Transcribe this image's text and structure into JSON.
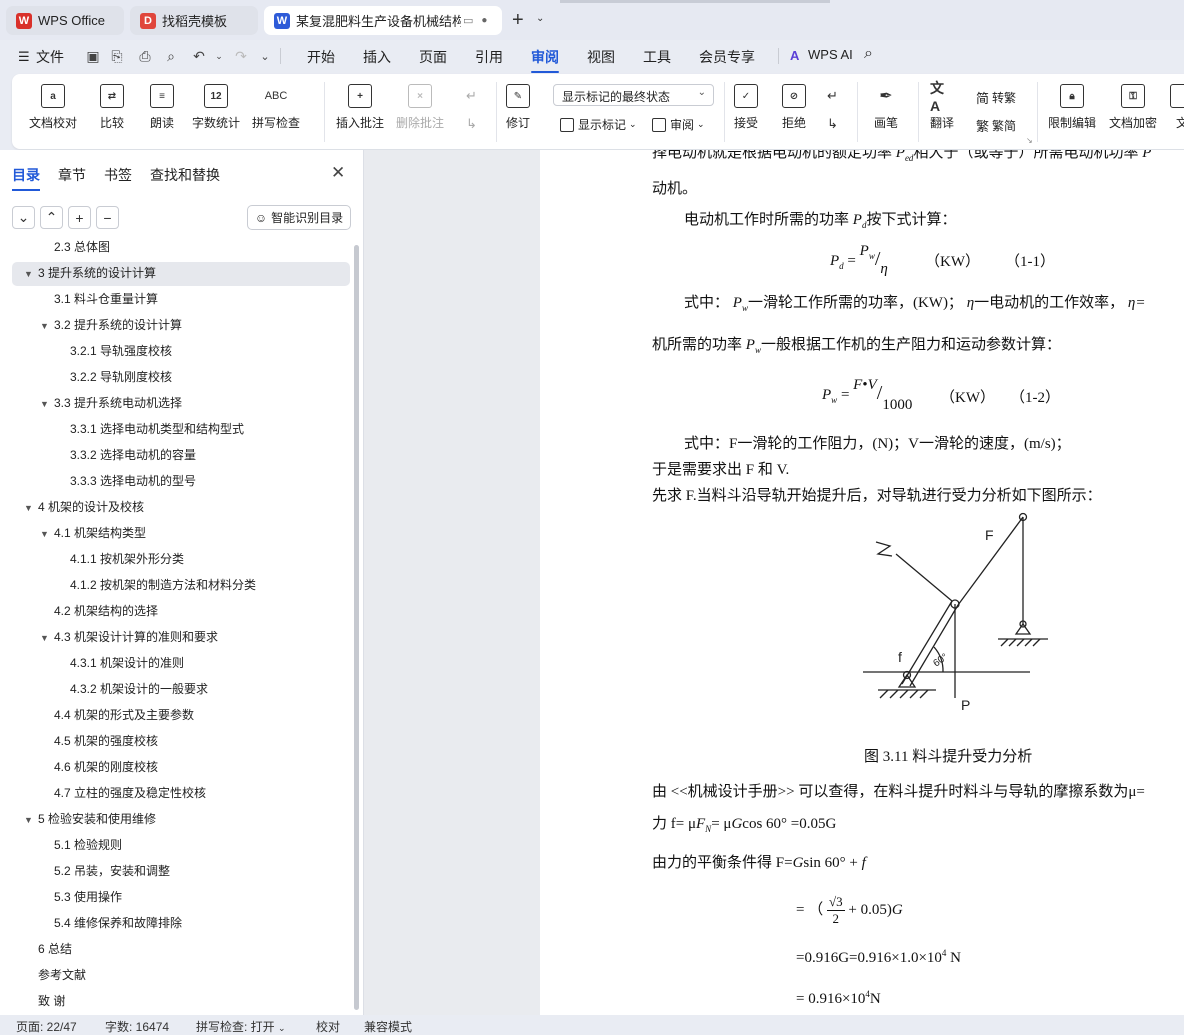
{
  "tabs": [
    {
      "label": "WPS Office",
      "icon": "wps-logo"
    },
    {
      "label": "找稻壳模板",
      "icon": "docer-logo"
    },
    {
      "label": "某复混肥料生产设备机械结构",
      "icon": "writer-logo"
    }
  ],
  "menu": {
    "file": "文件",
    "items": [
      "开始",
      "插入",
      "页面",
      "引用",
      "审阅",
      "视图",
      "工具",
      "会员专享"
    ],
    "active": "审阅",
    "ai": "WPS AI"
  },
  "ribbon": {
    "doc_check": "文档校对",
    "compare": "比较",
    "read_aloud": "朗读",
    "word_count": "字数统计",
    "spell_check": "拼写检查",
    "insert_comment": "插入批注",
    "delete_comment": "删除批注",
    "track": "修订",
    "markup_select": "显示标记的最终状态",
    "show_markup": "显示标记",
    "review": "审阅",
    "accept": "接受",
    "reject": "拒绝",
    "pen": "画笔",
    "translate": "翻译",
    "to_traditional": "转繁",
    "to_simplified": "繁简",
    "restrict_edit": "限制编辑",
    "doc_encrypt": "文档加密",
    "doc_more": "文"
  },
  "panel": {
    "tabs": [
      "目录",
      "章节",
      "书签",
      "查找和替换"
    ],
    "smart_toc": "智能识别目录",
    "toc": [
      {
        "text": "2.3  总体图",
        "level": 2,
        "arrow": false
      },
      {
        "text": "3  提升系统的设计计算",
        "level": 1,
        "arrow": true,
        "selected": true
      },
      {
        "text": "3.1  料斗仓重量计算",
        "level": 2,
        "arrow": false
      },
      {
        "text": "3.2  提升系统的设计计算",
        "level": 2,
        "arrow": true
      },
      {
        "text": "3.2.1  导轨强度校核",
        "level": 3,
        "arrow": false
      },
      {
        "text": "3.2.2  导轨刚度校核",
        "level": 3,
        "arrow": false
      },
      {
        "text": "3.3  提升系统电动机选择",
        "level": 2,
        "arrow": true
      },
      {
        "text": "3.3.1    选择电动机类型和结构型式",
        "level": 3,
        "arrow": false
      },
      {
        "text": "3.3.2  选择电动机的容量",
        "level": 3,
        "arrow": false
      },
      {
        "text": "3.3.3 选择电动机的型号",
        "level": 3,
        "arrow": false
      },
      {
        "text": "4  机架的设计及校核",
        "level": 1,
        "arrow": true
      },
      {
        "text": "4.1 机架结构类型",
        "level": 2,
        "arrow": true
      },
      {
        "text": "4.1.1  按机架外形分类",
        "level": 3,
        "arrow": false
      },
      {
        "text": "4.1.2  按机架的制造方法和材料分类",
        "level": 3,
        "arrow": false
      },
      {
        "text": "4.2  机架结构的选择",
        "level": 2,
        "arrow": false
      },
      {
        "text": "4.3  机架设计计算的准则和要求",
        "level": 2,
        "arrow": true
      },
      {
        "text": "4.3.1 机架设计的准则",
        "level": 3,
        "arrow": false
      },
      {
        "text": "4.3.2  机架设计的一般要求",
        "level": 3,
        "arrow": false
      },
      {
        "text": "4.4  机架的形式及主要参数",
        "level": 2,
        "arrow": false
      },
      {
        "text": "4.5 机架的强度校核",
        "level": 2,
        "arrow": false
      },
      {
        "text": "4.6 机架的刚度校核",
        "level": 2,
        "arrow": false
      },
      {
        "text": "4.7 立柱的强度及稳定性校核",
        "level": 2,
        "arrow": false
      },
      {
        "text": "5  检验安装和使用维修",
        "level": 1,
        "arrow": true
      },
      {
        "text": "5.1 检验规则",
        "level": 2,
        "arrow": false
      },
      {
        "text": "5.2 吊装，安装和调整",
        "level": 2,
        "arrow": false
      },
      {
        "text": "5.3 使用操作",
        "level": 2,
        "arrow": false
      },
      {
        "text": "5.4 维修保养和故障排除",
        "level": 2,
        "arrow": false
      },
      {
        "text": "6  总结",
        "level": 1,
        "arrow": false
      },
      {
        "text": "参考文献",
        "level": 1,
        "arrow": false
      },
      {
        "text": "致    谢",
        "level": 1,
        "arrow": false
      }
    ]
  },
  "doc": {
    "l0": "择电动机就是根据电动机的额定功率",
    "l0b": "相大于（或等于）所需电动机功率",
    "l1": "动机。",
    "l2a": "电动机工作时所需的功率 ",
    "l2b": "按下式计算：",
    "eq1_unit": "（KW）",
    "eq1_no": "（1-1）",
    "l3a": "式中：",
    "l3b": "一滑轮工作所需的功率，(KW)；",
    "l3c": "一电动机的工作效率，",
    "l4a": "机所需的功率 ",
    "l4b": "一般根据工作机的生产阻力和运动参数计算：",
    "eq2_den": "1000",
    "eq2_unit": "（KW）",
    "eq2_no": "（1-2）",
    "l5": "式中：F一滑轮的工作阻力，(N)；V一滑轮的速度，(m/s)；",
    "l6": "于是需要求出 F 和 V.",
    "l7": "先求 F.当料斗沿导轨开始提升后，对导轨进行受力分析如下图所示：",
    "fig_F": "F",
    "fig_f": "f",
    "fig_P": "P",
    "fig_angle": "60°",
    "caption": "图 3.11 料斗提升受力分析",
    "l8": "由 <<机械设计手册>> 可以查得，在料斗提升时料斗与导轨的摩擦系数为μ=",
    "l9a": "力 f= μ",
    "l9b": "= μ",
    "l9c": "cos 60° =0.05G",
    "l10a": "由力的平衡条件得 F=",
    "l10b": "sin 60° + ",
    "eq3a": "= （",
    "eq3b": "+ 0.05)",
    "eq4": "=0.916G=0.916×1.0×10",
    "eq4_exp": "4",
    "eq4_unit": " N",
    "eq5": "= 0.916×10",
    "eq5_exp": "4",
    "eq5_unit": "N"
  },
  "status": {
    "page": "页面: 22/47",
    "words": "字数: 16474",
    "spell": "拼写检查: 打开",
    "proof": "校对",
    "compat": "兼容模式"
  },
  "colors": {
    "accent": "#2159d8",
    "wps_red": "#d9302a",
    "writer_blue": "#2e5bd8"
  }
}
